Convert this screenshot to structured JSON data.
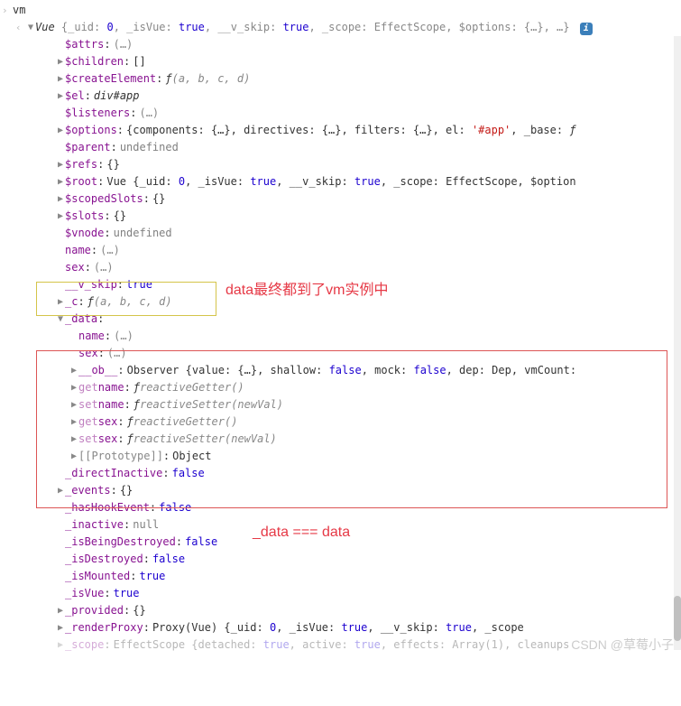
{
  "input_line": "vm",
  "vue_summary_prefix": "Vue ",
  "vue_summary": "{_uid: 0, _isVue: true, __v_skip: true, _scope: EffectScope, $options: {…}, …}",
  "props": {
    "attrs": {
      "name": "$attrs",
      "value": "(…)"
    },
    "children": {
      "name": "$children",
      "value": "[]"
    },
    "createElement": {
      "name": "$createElement",
      "fn": "ƒ ",
      "args": "(a, b, c, d)"
    },
    "el": {
      "name": "$el",
      "value": "div#app"
    },
    "listeners": {
      "name": "$listeners",
      "value": "(…)"
    },
    "options": {
      "name": "$options",
      "value": "{components: {…}, directives: {…}, filters: {…}, el: '#app', _base: ƒ"
    },
    "parent": {
      "name": "$parent",
      "value": "undefined"
    },
    "refs": {
      "name": "$refs",
      "value": "{}"
    },
    "root": {
      "name": "$root",
      "value": "Vue {_uid: 0, _isVue: true, __v_skip: true, _scope: EffectScope, $option"
    },
    "scopedSlots": {
      "name": "$scopedSlots",
      "value": "{}"
    },
    "slots": {
      "name": "$slots",
      "value": "{}"
    },
    "vnode": {
      "name": "$vnode",
      "value": "undefined"
    },
    "name_prop": {
      "name": "name",
      "value": "(…)"
    },
    "sex_prop": {
      "name": "sex",
      "value": "(…)"
    },
    "v_skip": {
      "name": "__v_skip",
      "value": "true"
    },
    "_c": {
      "name": "_c",
      "fn": "ƒ ",
      "args": "(a, b, c, d)"
    },
    "_data": {
      "name": "_data"
    },
    "data_name": {
      "name": "name",
      "value": "(…)"
    },
    "data_sex": {
      "name": "sex",
      "value": "(…)"
    },
    "ob": {
      "name": "__ob__",
      "value": "Observer {value: {…}, shallow: false, mock: false, dep: Dep, vmCount:"
    },
    "get_name": {
      "prefix": "get ",
      "name": "name",
      "fn": "ƒ ",
      "args": "reactiveGetter()"
    },
    "set_name": {
      "prefix": "set ",
      "name": "name",
      "fn": "ƒ ",
      "args": "reactiveSetter(newVal)"
    },
    "get_sex": {
      "prefix": "get ",
      "name": "sex",
      "fn": "ƒ ",
      "args": "reactiveGetter()"
    },
    "set_sex": {
      "prefix": "set ",
      "name": "sex",
      "fn": "ƒ ",
      "args": "reactiveSetter(newVal)"
    },
    "prototype": {
      "name": "[[Prototype]]",
      "value": "Object"
    },
    "directInactive": {
      "name": "_directInactive",
      "value": "false"
    },
    "events": {
      "name": "_events",
      "value": "{}"
    },
    "hasHookEvent": {
      "name": "_hasHookEvent",
      "value": "false"
    },
    "inactive": {
      "name": "_inactive",
      "value": "null"
    },
    "isBeingDestroyed": {
      "name": "_isBeingDestroyed",
      "value": "false"
    },
    "isDestroyed": {
      "name": "_isDestroyed",
      "value": "false"
    },
    "isMounted": {
      "name": "_isMounted",
      "value": "true"
    },
    "isVue": {
      "name": "_isVue",
      "value": "true"
    },
    "provided": {
      "name": "_provided",
      "value": "{}"
    },
    "renderProxy": {
      "name": "_renderProxy",
      "value": "Proxy(Vue) {_uid: 0, _isVue: true, __v_skip: true, _scope"
    },
    "scope_trail": {
      "name": "_scope",
      "value": "EffectScope {detached: true, active: true, effects: Array(1), cleanups"
    }
  },
  "annotations": {
    "yellow_text": "data最终都到了vm实例中",
    "red_text": "_data === data"
  },
  "watermark": "CSDN @草莓小子"
}
